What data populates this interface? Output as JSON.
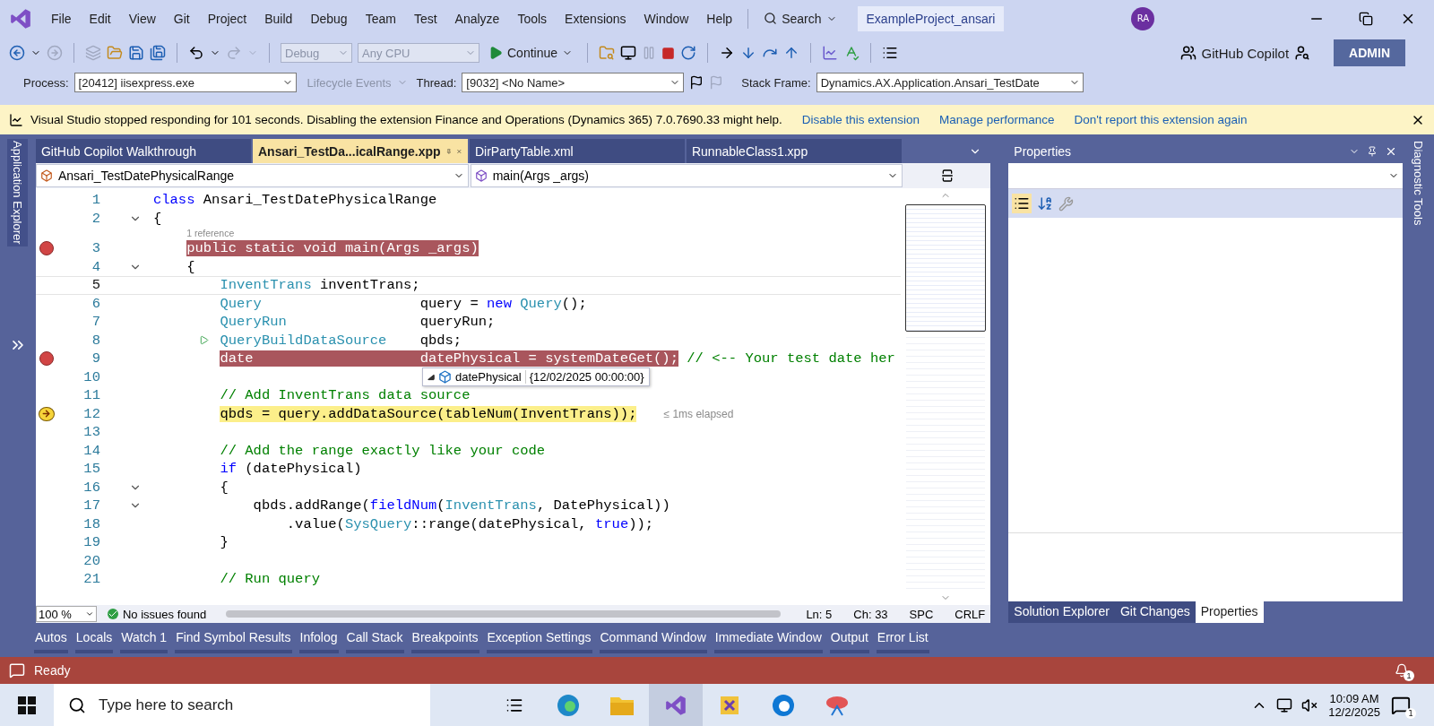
{
  "title_bar": {
    "menus": [
      "File",
      "Edit",
      "View",
      "Git",
      "Project",
      "Build",
      "Debug",
      "Team",
      "Test",
      "Analyze",
      "Tools",
      "Extensions",
      "Window",
      "Help"
    ],
    "search": "Search",
    "solution": "ExampleProject_ansari",
    "avatar": "RA"
  },
  "toolbar": {
    "configuration": {
      "value": "Debug",
      "disabled": true
    },
    "platform": {
      "value": "Any CPU",
      "disabled": true
    },
    "continue": "Continue",
    "copilot": "GitHub Copilot",
    "admin": "ADMIN"
  },
  "debug_location": {
    "process_label": "Process:",
    "process": "[20412] iisexpress.exe",
    "lifecycle": {
      "label": "Lifecycle Events",
      "disabled": true
    },
    "thread_label": "Thread:",
    "thread": "[9032] <No Name>",
    "stack_label": "Stack Frame:",
    "stack_frame": "Dynamics.AX.Application.Ansari_TestDate"
  },
  "info_bar": {
    "message": "Visual Studio stopped responding for 101 seconds. Disabling the extension Finance and Operations (Dynamics 365) 7.0.7690.33 might help.",
    "links": [
      "Disable this extension",
      "Manage performance",
      "Don't report this extension again"
    ]
  },
  "side_left": "Application Explorer",
  "side_right": "Diagnostic Tools",
  "editor": {
    "tabs": [
      {
        "label": "GitHub Copilot Walkthrough",
        "selected": false
      },
      {
        "label": "Ansari_TestDa...icalRange.xpp",
        "selected": true
      },
      {
        "label": "DirPartyTable.xml",
        "selected": false
      },
      {
        "label": "RunnableClass1.xpp",
        "selected": false
      }
    ],
    "nav": {
      "type": "Ansari_TestDatePhysicalRange",
      "member": "main(Args _args)"
    },
    "lines": [
      {
        "number": "1",
        "segments": [
          {
            "kind": "keyword",
            "text": "class"
          },
          {
            "kind": "plain",
            "text": " Ansari_TestDatePhysicalRange"
          }
        ]
      },
      {
        "number": "2",
        "fold": true,
        "segments": [
          {
            "kind": "plain",
            "text": "{"
          }
        ]
      },
      {
        "number": "3",
        "breakpoint": true,
        "codelens": "1 reference",
        "segments": [
          {
            "kind": "plain",
            "text": "    public static void main(Args _args)"
          }
        ]
      },
      {
        "number": "4",
        "fold": true,
        "segments": [
          {
            "kind": "plain",
            "text": "    {"
          }
        ]
      },
      {
        "number": "5",
        "cursor": true,
        "segments": [
          {
            "kind": "type",
            "text": "        InventTrans"
          },
          {
            "kind": "plain",
            "text": " inventTrans;"
          }
        ]
      },
      {
        "number": "6",
        "segments": [
          {
            "kind": "type",
            "text": "        Query"
          },
          {
            "kind": "plain",
            "text": "                   query = "
          },
          {
            "kind": "keyword",
            "text": "new"
          },
          {
            "kind": "type",
            "text": " Query"
          },
          {
            "kind": "plain",
            "text": "();"
          }
        ]
      },
      {
        "number": "7",
        "segments": [
          {
            "kind": "type",
            "text": "        QueryRun"
          },
          {
            "kind": "plain",
            "text": "                queryRun;"
          }
        ]
      },
      {
        "number": "8",
        "run_to_click": true,
        "segments": [
          {
            "kind": "type",
            "text": "        QueryBuildDataSource"
          },
          {
            "kind": "plain",
            "text": "    qbds;"
          }
        ]
      },
      {
        "number": "9",
        "breakpoint": true,
        "datatip": {
          "name": "datePhysical",
          "value": "{12/02/2025 00:00:00}"
        },
        "segments": [
          {
            "kind": "plain",
            "text": "        date                    datePhysical = systemDateGet();"
          },
          {
            "kind": "comment",
            "text": " // <-- Your test date her"
          }
        ]
      },
      {
        "number": "10"
      },
      {
        "number": "11",
        "segments": [
          {
            "kind": "comment",
            "text": "        // Add InventTrans data source"
          }
        ]
      },
      {
        "number": "12",
        "current": true,
        "perf_tip": "≤ 1ms elapsed",
        "segments": [
          {
            "kind": "plain",
            "text": "        qbds = query.addDataSource(tableNum(InventTrans));"
          }
        ]
      },
      {
        "number": "13"
      },
      {
        "number": "14",
        "segments": [
          {
            "kind": "comment",
            "text": "        // Add the range exactly like your code"
          }
        ]
      },
      {
        "number": "15",
        "segments": [
          {
            "kind": "keyword",
            "text": "        if"
          },
          {
            "kind": "plain",
            "text": " (datePhysical)"
          }
        ]
      },
      {
        "number": "16",
        "fold": true,
        "segments": [
          {
            "kind": "plain",
            "text": "        {"
          }
        ]
      },
      {
        "number": "17",
        "fold": true,
        "segments": [
          {
            "kind": "plain",
            "text": "            qbds.addRange("
          },
          {
            "kind": "keyword",
            "text": "fieldNum"
          },
          {
            "kind": "plain",
            "text": "("
          },
          {
            "kind": "type",
            "text": "InventTrans"
          },
          {
            "kind": "plain",
            "text": ", DatePhysical))"
          }
        ]
      },
      {
        "number": "18",
        "segments": [
          {
            "kind": "plain",
            "text": "                .value("
          },
          {
            "kind": "type",
            "text": "SysQuery"
          },
          {
            "kind": "plain",
            "text": "::range(datePhysical, "
          },
          {
            "kind": "keyword",
            "text": "true"
          },
          {
            "kind": "plain",
            "text": "));"
          }
        ]
      },
      {
        "number": "19",
        "segments": [
          {
            "kind": "plain",
            "text": "        }"
          }
        ]
      },
      {
        "number": "20"
      },
      {
        "number": "21",
        "segments": [
          {
            "kind": "comment",
            "text": "        // Run query"
          }
        ]
      }
    ],
    "status": {
      "zoom": "100 %",
      "issues": "No issues found",
      "line": "Ln: 5",
      "col": "Ch: 33",
      "whitespace": "SPC",
      "eol": "CRLF"
    }
  },
  "properties": {
    "title": "Properties",
    "tabs": [
      {
        "label": "Solution Explorer",
        "selected": false
      },
      {
        "label": "Git Changes",
        "selected": false
      },
      {
        "label": "Properties",
        "selected": true
      }
    ]
  },
  "tool_tabs": [
    "Autos",
    "Locals",
    "Watch 1",
    "Find Symbol Results",
    "Infolog",
    "Call Stack",
    "Breakpoints",
    "Exception Settings",
    "Command Window",
    "Immediate Window",
    "Output",
    "Error List"
  ],
  "status_bar": {
    "text": "Ready",
    "notifications": "1"
  },
  "taskbar": {
    "search_placeholder": "Type here to search",
    "time": "10:09 AM",
    "date": "12/2/2025",
    "notifications": "1"
  }
}
